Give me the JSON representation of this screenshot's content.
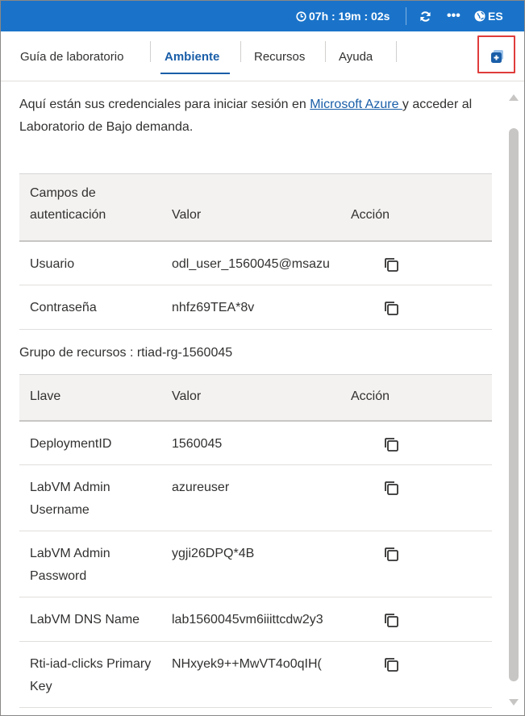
{
  "topbar": {
    "timer": "07h : 19m : 02s",
    "more": "•••",
    "language": "ES",
    "background_color": "#1a73c9"
  },
  "tabs": [
    {
      "label": "Guía de laboratorio",
      "active": false
    },
    {
      "label": "Ambiente",
      "active": true
    },
    {
      "label": "Recursos",
      "active": false
    },
    {
      "label": "Ayuda",
      "active": false
    }
  ],
  "intro": {
    "text_before": "Aquí están sus credenciales para iniciar sesión en ",
    "link": "Microsoft Azure ",
    "text_after": "y acceder al Laboratorio de Bajo demanda."
  },
  "auth_table": {
    "headers": [
      "Campos de autenticación",
      "Valor",
      "Acción"
    ],
    "rows": [
      {
        "field": "Usuario",
        "value": "odl_user_1560045@msazu"
      },
      {
        "field": "Contraseña",
        "value": "nhfz69TEA*8v"
      }
    ]
  },
  "resource_group": {
    "title": "Grupo de recursos : rtiad-rg-1560045"
  },
  "resource_table": {
    "headers": [
      "Llave",
      "Valor",
      "Acción"
    ],
    "rows": [
      {
        "key": "DeploymentID",
        "value": "1560045"
      },
      {
        "key": "LabVM Admin Username",
        "value": "azureuser"
      },
      {
        "key": "LabVM Admin Password",
        "value": "ygji26DPQ*4B"
      },
      {
        "key": "LabVM DNS Name",
        "value": "lab1560045vm6iiittcdw2y3"
      },
      {
        "key": "Rti-iad-clicks Primary Key",
        "value": "NHxyek9++MwVT4o0qIH("
      }
    ]
  },
  "icons": {
    "timer": "clock-icon",
    "refresh": "refresh-icon",
    "language": "globe-icon",
    "popout": "popout-icon",
    "copy": "copy-icon"
  },
  "colors": {
    "accent": "#1a5ea8",
    "highlight": "#e03c3c"
  }
}
